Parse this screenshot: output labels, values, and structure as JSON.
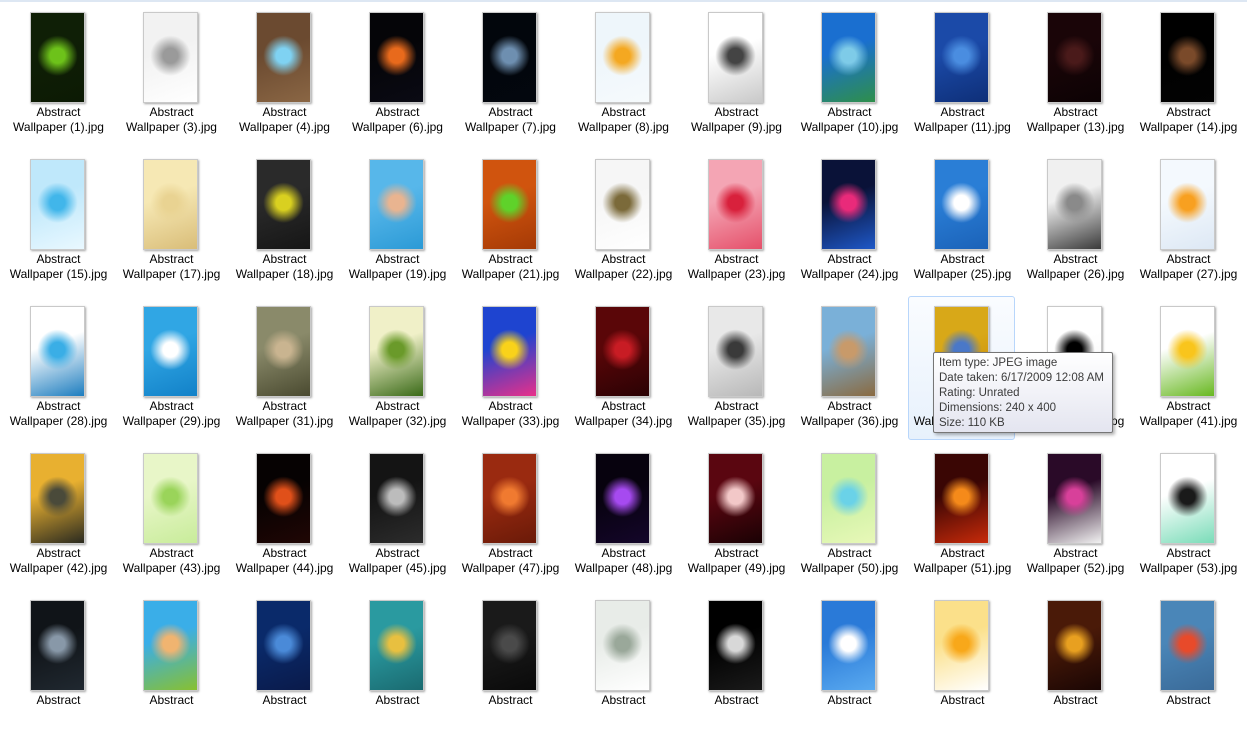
{
  "window": {
    "view": "Large Icons"
  },
  "files": [
    {
      "line1": "Abstract",
      "line2": "Wallpaper (1).jpg",
      "c1": "#0f1f06",
      "c2": "#6dc21a",
      "c3": "#0c1a04"
    },
    {
      "line1": "Abstract",
      "line2": "Wallpaper (3).jpg",
      "c1": "#f2f2f2",
      "c2": "#9a9a9a",
      "c3": "#ffffff"
    },
    {
      "line1": "Abstract",
      "line2": "Wallpaper (4).jpg",
      "c1": "#6b4a30",
      "c2": "#7fd2f2",
      "c3": "#8a6644"
    },
    {
      "line1": "Abstract",
      "line2": "Wallpaper (6).jpg",
      "c1": "#050508",
      "c2": "#e86a1c",
      "c3": "#0a0a14"
    },
    {
      "line1": "Abstract",
      "line2": "Wallpaper (7).jpg",
      "c1": "#02060c",
      "c2": "#6e8fb0",
      "c3": "#03070e"
    },
    {
      "line1": "Abstract",
      "line2": "Wallpaper (8).jpg",
      "c1": "#eef6fb",
      "c2": "#f4a821",
      "c3": "#f6fafc"
    },
    {
      "line1": "Abstract",
      "line2": "Wallpaper (9).jpg",
      "c1": "#ffffff",
      "c2": "#444444",
      "c3": "#c9c9c9"
    },
    {
      "line1": "Abstract",
      "line2": "Wallpaper (10).jpg",
      "c1": "#1a6fd0",
      "c2": "#7ecbe8",
      "c3": "#2e8f4a"
    },
    {
      "line1": "Abstract",
      "line2": "Wallpaper (11).jpg",
      "c1": "#1b4aa8",
      "c2": "#4a8de0",
      "c3": "#0e2f78"
    },
    {
      "line1": "Abstract",
      "line2": "Wallpaper (13).jpg",
      "c1": "#1a0508",
      "c2": "#4a1a1a",
      "c3": "#0c0204"
    },
    {
      "line1": "Abstract",
      "line2": "Wallpaper (14).jpg",
      "c1": "#000000",
      "c2": "#7a4a2a",
      "c3": "#030303"
    },
    {
      "line1": "Abstract",
      "line2": "Wallpaper (15).jpg",
      "c1": "#bfe8fb",
      "c2": "#41b6ea",
      "c3": "#e9f8ff"
    },
    {
      "line1": "Abstract",
      "line2": "Wallpaper (17).jpg",
      "c1": "#f6e8b4",
      "c2": "#e9d392",
      "c3": "#d9bd78"
    },
    {
      "line1": "Abstract",
      "line2": "Wallpaper (18).jpg",
      "c1": "#2a2a2a",
      "c2": "#d9d020",
      "c3": "#161616"
    },
    {
      "line1": "Abstract",
      "line2": "Wallpaper (19).jpg",
      "c1": "#57b7ea",
      "c2": "#e9b490",
      "c3": "#2b9ad6"
    },
    {
      "line1": "Abstract",
      "line2": "Wallpaper (21).jpg",
      "c1": "#d0540e",
      "c2": "#5fd22a",
      "c3": "#a53a06"
    },
    {
      "line1": "Abstract",
      "line2": "Wallpaper (22).jpg",
      "c1": "#f6f6f6",
      "c2": "#7b6a3a",
      "c3": "#ffffff"
    },
    {
      "line1": "Abstract",
      "line2": "Wallpaper (23).jpg",
      "c1": "#f4a5b4",
      "c2": "#d8213c",
      "c3": "#e5506a"
    },
    {
      "line1": "Abstract",
      "line2": "Wallpaper (24).jpg",
      "c1": "#0a1238",
      "c2": "#e92a7a",
      "c3": "#1e58c8"
    },
    {
      "line1": "Abstract",
      "line2": "Wallpaper (25).jpg",
      "c1": "#2a7ed6",
      "c2": "#ffffff",
      "c3": "#1b62b8"
    },
    {
      "line1": "Abstract",
      "line2": "Wallpaper (26).jpg",
      "c1": "#f0f0f0",
      "c2": "#8a8a8a",
      "c3": "#3a3a3a"
    },
    {
      "line1": "Abstract",
      "line2": "Wallpaper (27).jpg",
      "c1": "#f4f9fe",
      "c2": "#f8a020",
      "c3": "#dde8f4"
    },
    {
      "line1": "Abstract",
      "line2": "Wallpaper (28).jpg",
      "c1": "#ffffff",
      "c2": "#3aaee6",
      "c3": "#1d7dbf"
    },
    {
      "line1": "Abstract",
      "line2": "Wallpaper (29).jpg",
      "c1": "#30a6e4",
      "c2": "#ffffff",
      "c3": "#1281c8"
    },
    {
      "line1": "Abstract",
      "line2": "Wallpaper (31).jpg",
      "c1": "#8a8a6a",
      "c2": "#c9b490",
      "c3": "#4a4a30"
    },
    {
      "line1": "Abstract",
      "line2": "Wallpaper (32).jpg",
      "c1": "#f0f0c8",
      "c2": "#6a9a2a",
      "c3": "#3a6a18"
    },
    {
      "line1": "Abstract",
      "line2": "Wallpaper (33).jpg",
      "c1": "#1e44d0",
      "c2": "#f9d21a",
      "c3": "#e9308a"
    },
    {
      "line1": "Abstract",
      "line2": "Wallpaper (34).jpg",
      "c1": "#5a0608",
      "c2": "#c81c24",
      "c3": "#2a0204"
    },
    {
      "line1": "Abstract",
      "line2": "Wallpaper (35).jpg",
      "c1": "#e8e8e8",
      "c2": "#3a3a3a",
      "c3": "#b8b8b8"
    },
    {
      "line1": "Abstract",
      "line2": "Wallpaper (36).jpg",
      "c1": "#7ab0d8",
      "c2": "#c89a6a",
      "c3": "#8a6a40"
    },
    {
      "line1": "Abstract",
      "line2": "Wallpaper (37).jpg",
      "c1": "#d8a818",
      "c2": "#4a78c8",
      "c3": "#c8860a"
    },
    {
      "line1": "Abstract",
      "line2": "Wallpaper (39).jpg",
      "c1": "#ffffff",
      "c2": "#000000",
      "c3": "#f4f4f4"
    },
    {
      "line1": "Abstract",
      "line2": "Wallpaper (41).jpg",
      "c1": "#ffffff",
      "c2": "#f9c51c",
      "c3": "#68b820"
    },
    {
      "line1": "Abstract",
      "line2": "Wallpaper (42).jpg",
      "c1": "#e8b030",
      "c2": "#4a4a3a",
      "c3": "#2a2a20"
    },
    {
      "line1": "Abstract",
      "line2": "Wallpaper (43).jpg",
      "c1": "#e8f6c8",
      "c2": "#9ad45a",
      "c3": "#c8ec9a"
    },
    {
      "line1": "Abstract",
      "line2": "Wallpaper (44).jpg",
      "c1": "#060202",
      "c2": "#e0501a",
      "c3": "#200604"
    },
    {
      "line1": "Abstract",
      "line2": "Wallpaper (45).jpg",
      "c1": "#141414",
      "c2": "#bcbcbc",
      "c3": "#2c2c2c"
    },
    {
      "line1": "Abstract",
      "line2": "Wallpaper (47).jpg",
      "c1": "#9a2a10",
      "c2": "#f07a30",
      "c3": "#6a1a08"
    },
    {
      "line1": "Abstract",
      "line2": "Wallpaper (48).jpg",
      "c1": "#07020e",
      "c2": "#a64af0",
      "c3": "#14062a"
    },
    {
      "line1": "Abstract",
      "line2": "Wallpaper (49).jpg",
      "c1": "#5a0610",
      "c2": "#f2c8c8",
      "c3": "#1a0204"
    },
    {
      "line1": "Abstract",
      "line2": "Wallpaper (50).jpg",
      "c1": "#c8f0a0",
      "c2": "#6ad2e8",
      "c3": "#e8f8b8"
    },
    {
      "line1": "Abstract",
      "line2": "Wallpaper (51).jpg",
      "c1": "#3a0604",
      "c2": "#f58a1a",
      "c3": "#c82a0a"
    },
    {
      "line1": "Abstract",
      "line2": "Wallpaper (52).jpg",
      "c1": "#2a0a28",
      "c2": "#d8409a",
      "c3": "#f2f2f2"
    },
    {
      "line1": "Abstract",
      "line2": "Wallpaper (53).jpg",
      "c1": "#ffffff",
      "c2": "#1a1a1a",
      "c3": "#7adcb8"
    },
    {
      "line1": "Abstract",
      "line2": "",
      "c1": "#101418",
      "c2": "#8898a8",
      "c3": "#202830"
    },
    {
      "line1": "Abstract",
      "line2": "",
      "c1": "#3aaee8",
      "c2": "#f0b470",
      "c3": "#88c030"
    },
    {
      "line1": "Abstract",
      "line2": "",
      "c1": "#0a2a6a",
      "c2": "#4a8ad8",
      "c3": "#0a1a4a"
    },
    {
      "line1": "Abstract",
      "line2": "",
      "c1": "#2a9aa0",
      "c2": "#e8c040",
      "c3": "#1a6a70"
    },
    {
      "line1": "Abstract",
      "line2": "",
      "c1": "#1a1a1a",
      "c2": "#4a4a4a",
      "c3": "#0a0a0a"
    },
    {
      "line1": "Abstract",
      "line2": "",
      "c1": "#e8ece8",
      "c2": "#9aa89a",
      "c3": "#ffffff"
    },
    {
      "line1": "Abstract",
      "line2": "",
      "c1": "#000000",
      "c2": "#d8d8d8",
      "c3": "#1a1a1a"
    },
    {
      "line1": "Abstract",
      "line2": "",
      "c1": "#2a7ad8",
      "c2": "#ffffff",
      "c3": "#5aaaf0"
    },
    {
      "line1": "Abstract",
      "line2": "",
      "c1": "#fbe08a",
      "c2": "#f8a81a",
      "c3": "#ffffff"
    },
    {
      "line1": "Abstract",
      "line2": "",
      "c1": "#4a1a08",
      "c2": "#e8a020",
      "c3": "#1a0604"
    },
    {
      "line1": "Abstract",
      "line2": "",
      "c1": "#4a86b8",
      "c2": "#e84a2a",
      "c3": "#3a6a98"
    }
  ],
  "hovered_index": 30,
  "tooltip": {
    "type_line": "Item type: JPEG image",
    "date_line": "Date taken: 6/17/2009 12:08 AM",
    "rating_line": "Rating: Unrated",
    "dimensions_line": "Dimensions: 240 x 400",
    "size_line": "Size: 110 KB"
  }
}
